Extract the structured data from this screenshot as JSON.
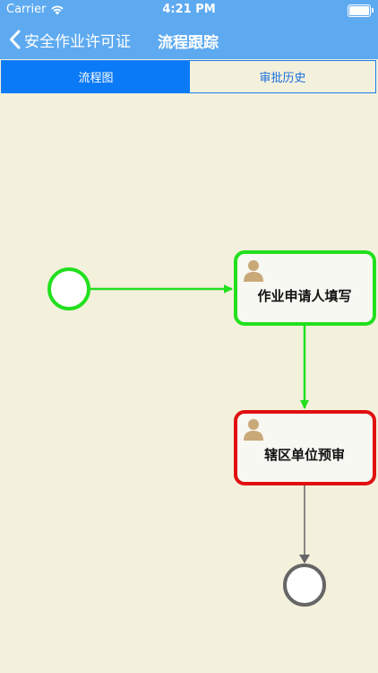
{
  "status_bar": {
    "carrier": "Carrier",
    "time": "4:21 PM",
    "battery_level": 1.0
  },
  "nav": {
    "back_label": "安全作业许可证",
    "title": "流程跟踪"
  },
  "tabs": [
    {
      "label": "流程图",
      "active": true
    },
    {
      "label": "审批历史",
      "active": false
    }
  ],
  "flow": {
    "tasks": [
      {
        "label": "作业申请人填写",
        "state": "completed"
      },
      {
        "label": "辖区单位预审",
        "state": "current"
      }
    ],
    "colors": {
      "background": "#f3f0dc",
      "completed": "#22e01e",
      "current": "#e01010",
      "pending": "#666666",
      "header": "#5eaaf0",
      "tab_active": "#0a7af7"
    }
  }
}
